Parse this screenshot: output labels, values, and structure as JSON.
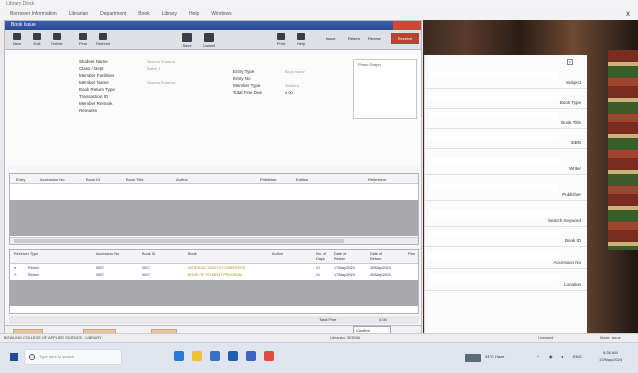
{
  "host": {
    "title": "Library Desk",
    "menu": [
      "Borrower Information",
      "Librarian",
      "Department",
      "Book",
      "Library",
      "Help",
      "Windows"
    ],
    "close": "x"
  },
  "window": {
    "title": "Book Issue",
    "toolbar": [
      {
        "label": "New",
        "icon": "new-icon"
      },
      {
        "label": "Edit",
        "icon": "edit-icon"
      },
      {
        "label": "Delete",
        "icon": "delete-icon"
      },
      {
        "label": "Find",
        "icon": "find-icon"
      },
      {
        "label": "Refresh",
        "icon": "refresh-icon"
      },
      {
        "label": "Save",
        "icon": "save-icon"
      },
      {
        "label": "Cancel",
        "icon": "cancel-icon"
      },
      {
        "label": "Print",
        "icon": "print-icon"
      },
      {
        "label": "Help",
        "icon": "help-icon"
      }
    ],
    "toolbar_right": [
      "Issue",
      "Return",
      "Renew"
    ],
    "return_tab": "Receive"
  },
  "form": {
    "labels": [
      "Student Name",
      "Class / Dept",
      "Member Facilities",
      "Member Name",
      "Book Return Type",
      "Transaction ID",
      "Member Remark",
      "Remarks"
    ],
    "mid_labels": [
      "Entry Type",
      "Entry No",
      "Member Type",
      "Total Fine Due"
    ],
    "mid_values": [
      "Book Issue",
      "",
      "Student",
      "0.00"
    ],
    "values_left": [
      "Seema Sharma",
      "Batch 1",
      "",
      "Seema Sharma"
    ],
    "photo_label": "Photo Graph"
  },
  "grid1": {
    "headers": [
      "Entry",
      "Accession No",
      "Book ID",
      "Book Title",
      "Author",
      "Publisher",
      "Edition",
      "Reference"
    ]
  },
  "grid2": {
    "headers": [
      "Receiver Type",
      "Accession No",
      "Book ID",
      "Book",
      "Author",
      "No. of Days",
      "Date of Return",
      "Date of Return",
      "Fine"
    ],
    "rows": [
      [
        "Return",
        "0007",
        "0017",
        "INTRODUCTION TO COMPUTERS",
        "21",
        "17/May/2024",
        "30/May/2024"
      ],
      [
        "Return",
        "0007",
        "0017",
        "BOOK OF STUDENT PROGRAM",
        "21",
        "17/May/2024",
        "30/May/2024"
      ]
    ]
  },
  "totals": {
    "label": "Total Fine",
    "value": "0.00"
  },
  "tabs": [
    "Member Ac",
    "Book Activity",
    "Remarks"
  ],
  "confirm": "Confirm",
  "right_panel": {
    "fields": [
      "Subject",
      "Book Type",
      "Book Title",
      "ISBN",
      "Writer",
      "Publisher",
      "Search Keyword",
      "Book ID",
      "Accession No",
      "Location"
    ]
  },
  "status": {
    "left": "BOWLING COLLEGE OF APPLIED SCIENCE - LIBRARY",
    "mid": "Librarian: SEEMA",
    "right_a": "Licensed",
    "right_b": "Mode: Issue"
  },
  "taskbar": {
    "search_placeholder": "Type here to search",
    "tray_temp": "34°C Haze",
    "time": "9:28 AM",
    "date": "17/May/2024",
    "lang": "ENG"
  }
}
